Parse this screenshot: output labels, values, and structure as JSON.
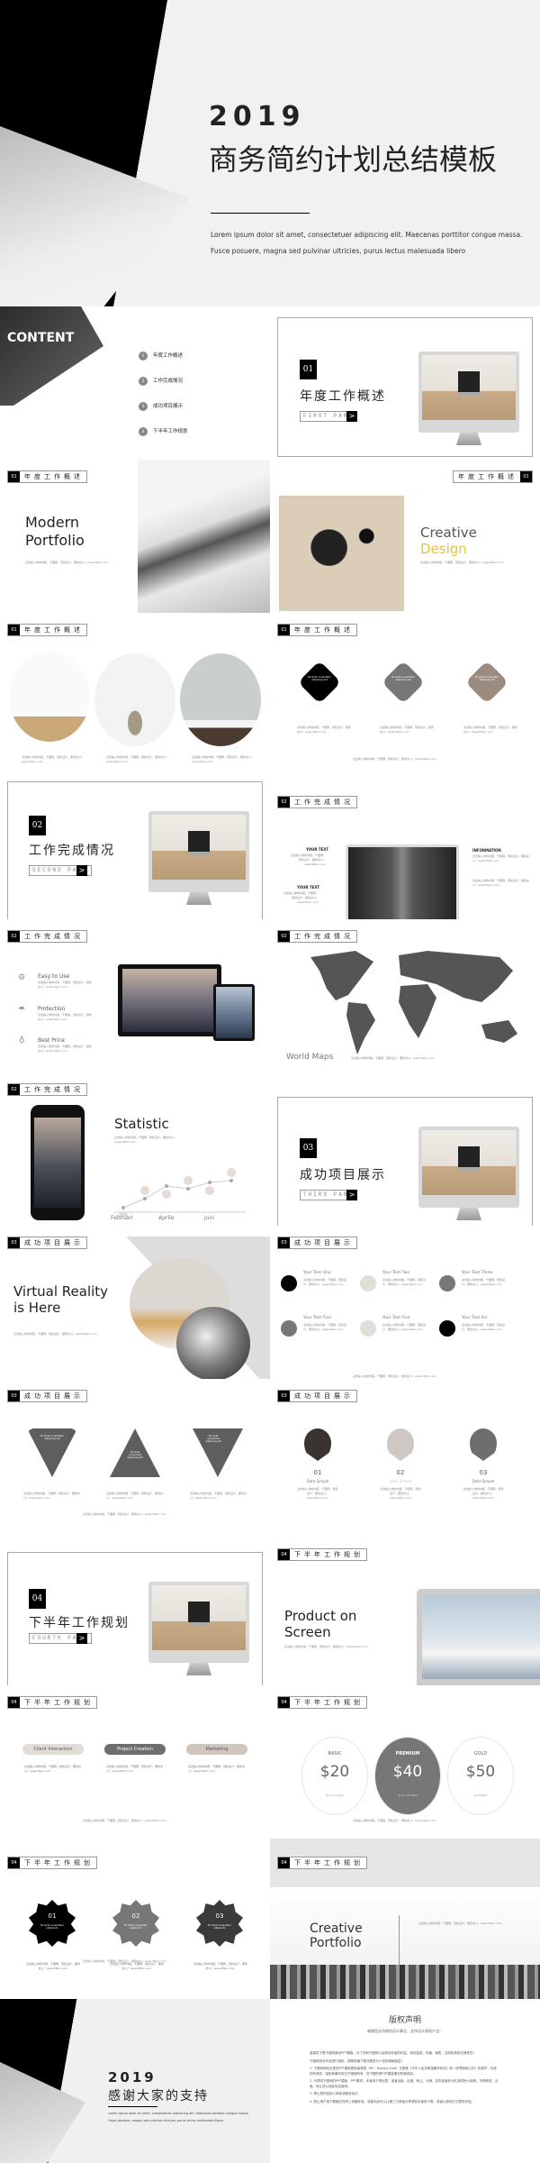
{
  "hero": {
    "year": "2019",
    "title": "商务简约计划总结模板",
    "desc1": "Lorem ipsum dolor sit amet, consectetuer adipiscing elit. Maecenas porttitor congue massa.",
    "desc2": "Fusce posuere, magna sed pulvinar ultricies, purus lectus malesuada libero"
  },
  "contents": {
    "label": "CONTENT",
    "items": [
      {
        "num": "1",
        "title": "年度工作概述"
      },
      {
        "num": "2",
        "title": "工作完成情况"
      },
      {
        "num": "3",
        "title": "成功项目展示"
      },
      {
        "num": "4",
        "title": "下半年工作规划"
      }
    ],
    "sub": "Fusce posuere, magna sed pulvinar ultricies, purus lectus malesuada libero"
  },
  "sections": [
    {
      "num": "01",
      "title": "年度工作概述",
      "part": "FIRST PART"
    },
    {
      "num": "02",
      "title": "工作完成情况",
      "part": "SECOND PART"
    },
    {
      "num": "03",
      "title": "成功项目展示",
      "part": "THIRD PART"
    },
    {
      "num": "04",
      "title": "下半年工作规划",
      "part": "FOURTH PART"
    }
  ],
  "arrow": ">",
  "placeholder": "点击输入你的内容，千图网，轻松设计，服务办公！www.58pic.com",
  "portfolio": {
    "line1": "Modern",
    "line2": "Portfolio"
  },
  "creative": {
    "line1": "Creative",
    "line2": "Design",
    "accent": "#e6c42e"
  },
  "shape_text": "Sit amet consectetur adipiscing elit",
  "monitor_slide": {
    "left1": "YOUR TEXT",
    "left2": "YOUR TEXT",
    "right": "INFORMATION"
  },
  "features": [
    {
      "title": "Easy to Use",
      "icon": "gear-icon"
    },
    {
      "title": "Protection",
      "icon": "umbrella-icon"
    },
    {
      "title": "Best Price",
      "icon": "lightbulb-icon"
    }
  ],
  "map": {
    "label": "World Maps"
  },
  "statistic": {
    "title": "Statistic",
    "months": [
      "Februari",
      "Aprile",
      "Juni"
    ],
    "points": [
      1,
      2,
      3.4,
      3.1,
      3.8,
      4
    ]
  },
  "vr": {
    "line1": "Virtual Reality",
    "line2": "is Here"
  },
  "six": [
    {
      "t": "Your Text One",
      "c": "#000"
    },
    {
      "t": "Your Text Two",
      "c": "#e3ddd8"
    },
    {
      "t": "Your Text Three",
      "c": "#777"
    },
    {
      "t": "Your Text Four",
      "c": "#777"
    },
    {
      "t": "Your Text Five",
      "c": "#e3ddd8"
    },
    {
      "t": "Your Text Six",
      "c": "#000"
    }
  ],
  "pins": [
    {
      "n": "01",
      "t": "Data Simple",
      "c": "#3a3330"
    },
    {
      "n": "02",
      "t": "Data Simple",
      "c": "#cfc8c2"
    },
    {
      "n": "03",
      "t": "Data Simple",
      "c": "#6e6e6e"
    }
  ],
  "product": {
    "line1": "Product on",
    "line2": "Screen"
  },
  "pills": [
    {
      "t": "Client Interaction",
      "c": "#e2dcd7",
      "fg": "#555"
    },
    {
      "t": "Project Creation",
      "c": "#6e6e6e",
      "fg": "#fff"
    },
    {
      "t": "Marketing",
      "c": "#cfc6bf",
      "fg": "#555"
    }
  ],
  "pricing": [
    {
      "name": "BASIC",
      "price": "$20",
      "note": "Up to 5 Users"
    },
    {
      "name": "PREMIUM",
      "price": "$40",
      "note": "Up to 50 Users"
    },
    {
      "name": "GOLD",
      "price": "$50",
      "note": "Unlimited"
    }
  ],
  "stars": [
    {
      "n": "01",
      "c": "#000"
    },
    {
      "n": "02",
      "c": "#777"
    },
    {
      "n": "03",
      "c": "#3a3a3a"
    }
  ],
  "star_text": "Sit amet consectetur adipiscodo",
  "portfolio2": {
    "line1": "Creative",
    "line2": "Portfolio"
  },
  "thanks": {
    "year": "2019",
    "title": "感谢大家的支持"
  },
  "copyright": {
    "title": "版权声明",
    "subtitle": "感谢您支持原创设计事业，支持设计版权产品！",
    "paras": [
      "感谢您下载千图网原创PPT模板，为了您和千图网以及原创作者的利益，请勿复制、传播、销售，否则将承担法律责任！",
      "千图网将对作品进行维权，按照传播下载次数进行十倍的索取赔偿！",
      "1. 千图网网站出售的PPT模板是免版税类（RF：Royalty-free）正版受《中华人民共和国著作权法》和《世界版权公约》的保护，作品的所有权、版权和著作权归千图网所有，您下载的是PPT模板素材的使用权。",
      "2. 不得将千图网的PPT模板、PPT素材，本身用于再出售，或者出租、出借、转让、分销、发布或者作为礼物供他人使用，不得修改、出版、转让或以违反协议使用。",
      "3. 禁止把作品纳入商标或服务标识。",
      "4. 禁止用户用下载格式在网上传播作品，或者作品可以让第三方单独分享或转手使用下载，或者以其他方式提供作品。"
    ]
  }
}
